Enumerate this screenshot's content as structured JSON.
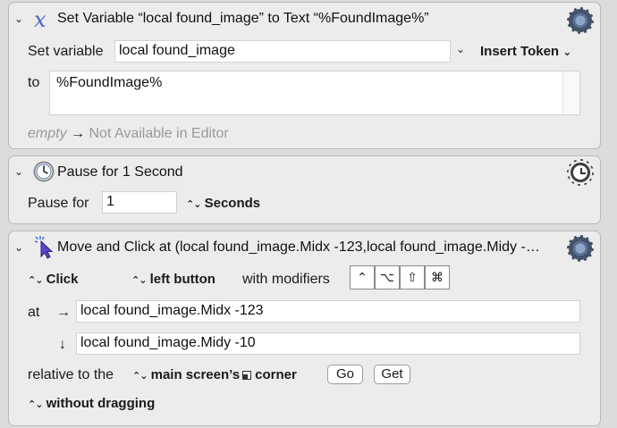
{
  "actions": [
    {
      "title": "Set Variable “local found_image” to Text “%FoundImage%”",
      "icon": "variable-x-icon",
      "set_variable_label": "Set variable",
      "variable_value": "local found_image",
      "insert_token_label": "Insert Token",
      "to_label": "to",
      "text_value": "%FoundImage%",
      "empty_label": "empty",
      "arrow": "→",
      "not_available": "Not Available in Editor"
    },
    {
      "title": "Pause for 1 Second",
      "icon": "clock-icon",
      "pause_for_label": "Pause for",
      "pause_value": "1",
      "unit_label": "Seconds"
    },
    {
      "title": "Move and Click at (local found_image.Midx -123,local found_image.Midy -…",
      "icon": "cursor-click-icon",
      "click_label": "Click",
      "button_label": "left button",
      "modifiers_label": "with modifiers",
      "modifiers": [
        "⌃",
        "⌥",
        "⇧",
        "⌘"
      ],
      "at_label": "at",
      "x_arrow": "→",
      "x_value": "local found_image.Midx -123",
      "y_arrow": "↓",
      "y_value": "local found_image.Midy -10",
      "relative_label": "relative to the",
      "relative_value": "main screen’s",
      "corner_label": "corner",
      "go_label": "Go",
      "get_label": "Get",
      "drag_label": "without dragging"
    }
  ]
}
